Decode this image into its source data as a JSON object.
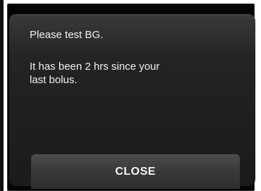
{
  "alert": {
    "line1": "Please test BG.",
    "line2": "It has been 2 hrs since your",
    "line3": "last bolus."
  },
  "actions": {
    "close_label": "CLOSE"
  },
  "colors": {
    "screen_background": "#050505",
    "panel_top": "#3a3a3a",
    "panel_bottom": "#1b1b1b",
    "text": "#f2f2f2",
    "button": "#3a3a3a"
  }
}
